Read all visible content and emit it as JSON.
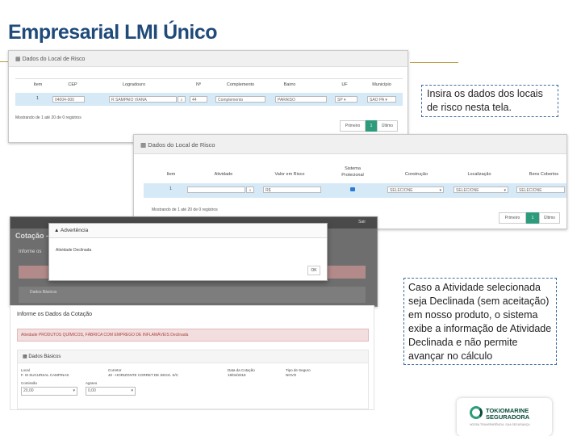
{
  "slide": {
    "title": "Empresarial LMI Único"
  },
  "shot1": {
    "panel_title": "Dados do Local de Risco",
    "headers": [
      "Item",
      "CEP",
      "Logradouro",
      "Nº",
      "Complemento",
      "Bairro",
      "UF",
      "Município"
    ],
    "row": {
      "item": "1",
      "cep": "04004-000",
      "logradouro": "R SAMPAIO VIANA",
      "numero": "44",
      "complemento": "Complemento",
      "bairro": "PARAISO",
      "uf": "SP",
      "municipio": "SAO PA"
    },
    "status": "Mostrando de 1 até 20 de 0 registros",
    "pager": {
      "first": "Primeiro",
      "page": "1",
      "last": "Último"
    }
  },
  "shot2": {
    "panel_title": "Dados do Local de Risco",
    "headers": [
      "Item",
      "Atividade",
      "Valor em Risco",
      "Sistema Protecional",
      "Construção",
      "Localização",
      "Bens Cobertos"
    ],
    "row": {
      "item": "1",
      "atividade": "",
      "valor": "R$",
      "construcao": "SELECIONE",
      "localizacao": "SELECIONE",
      "bens": "SELECIONE"
    },
    "status": "Mostrando de 1 até 20 de 0 registros",
    "pager": {
      "first": "Primeiro",
      "page": "1",
      "last": "Último"
    }
  },
  "shot3": {
    "top_label": "Cotação -",
    "corner_text": "Sair",
    "section_label": "Informe os",
    "basic_label": "Dados Básicos",
    "modal": {
      "title": "Advertência",
      "message": "Atividade Declinada",
      "ok": "OK"
    }
  },
  "shot4": {
    "heading": "Informe os Dados da Cotação",
    "alert": "Atividade PRODUTOS QUÍMICOS, FÁBRICA COM EMPREGO DE INFLAMÁVEIS Declinada",
    "section": "Dados Básicos",
    "fields": [
      {
        "label": "Local",
        "value": "F. SI SUCURSAL CAMPINAS"
      },
      {
        "label": "Corretor",
        "value": "40 - HORIZONTE CORRET DE SEGS. S/C"
      },
      {
        "label": "Data da Cotação",
        "value": "19/04/2018"
      },
      {
        "label": "Tipo de Seguro",
        "value": "NOVO"
      }
    ],
    "selects": [
      {
        "label": "Comissão",
        "value": "20,00"
      },
      {
        "label": "Agravo",
        "value": "0,00"
      }
    ]
  },
  "notes": {
    "note1": "Insira os dados dos locais de risco nesta tela.",
    "note2": "Caso a Atividade selecionada seja Declinada (sem aceitação) em nosso produto, o sistema exibe a informação de Atividade Declinada e não permite avançar no cálculo"
  },
  "logo": {
    "line1": "TOKIOMARINE",
    "line2": "SEGURADORA",
    "tagline": "NOSSA TRANSPARÊNCIA. SUA SEGURANÇA"
  },
  "colors": {
    "title": "#1f4a7a",
    "accent_green": "#2e9c7c",
    "alert_bg": "#f2dede",
    "selected_row": "#d6e9f7"
  }
}
